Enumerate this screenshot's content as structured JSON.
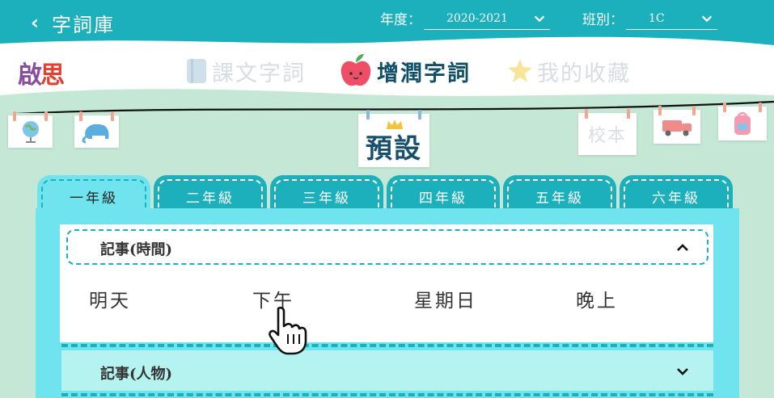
{
  "header": {
    "back_label": "字詞庫",
    "year_label": "年度：",
    "year_value": "2020-2021",
    "class_label": "班別：",
    "class_value": "1C"
  },
  "brand": {
    "part1": "啟",
    "part2": "思"
  },
  "nav": {
    "textbook": "課文字詞",
    "enrich": "增潤字詞",
    "favorites": "我的收藏"
  },
  "cards": {
    "preset": "預設",
    "school": "校本"
  },
  "grades": [
    "一年級",
    "二年級",
    "三年級",
    "四年級",
    "五年級",
    "六年級"
  ],
  "sections": [
    {
      "title": "記事(時間)",
      "words": [
        "明天",
        "下午",
        "星期日",
        "晚上"
      ]
    },
    {
      "title": "記事(人物)"
    }
  ],
  "colors": {
    "teal": "#1cb0bd",
    "light_teal": "#6fe4ee",
    "navy": "#0f4f6a",
    "mint": "#c5e8d6"
  }
}
